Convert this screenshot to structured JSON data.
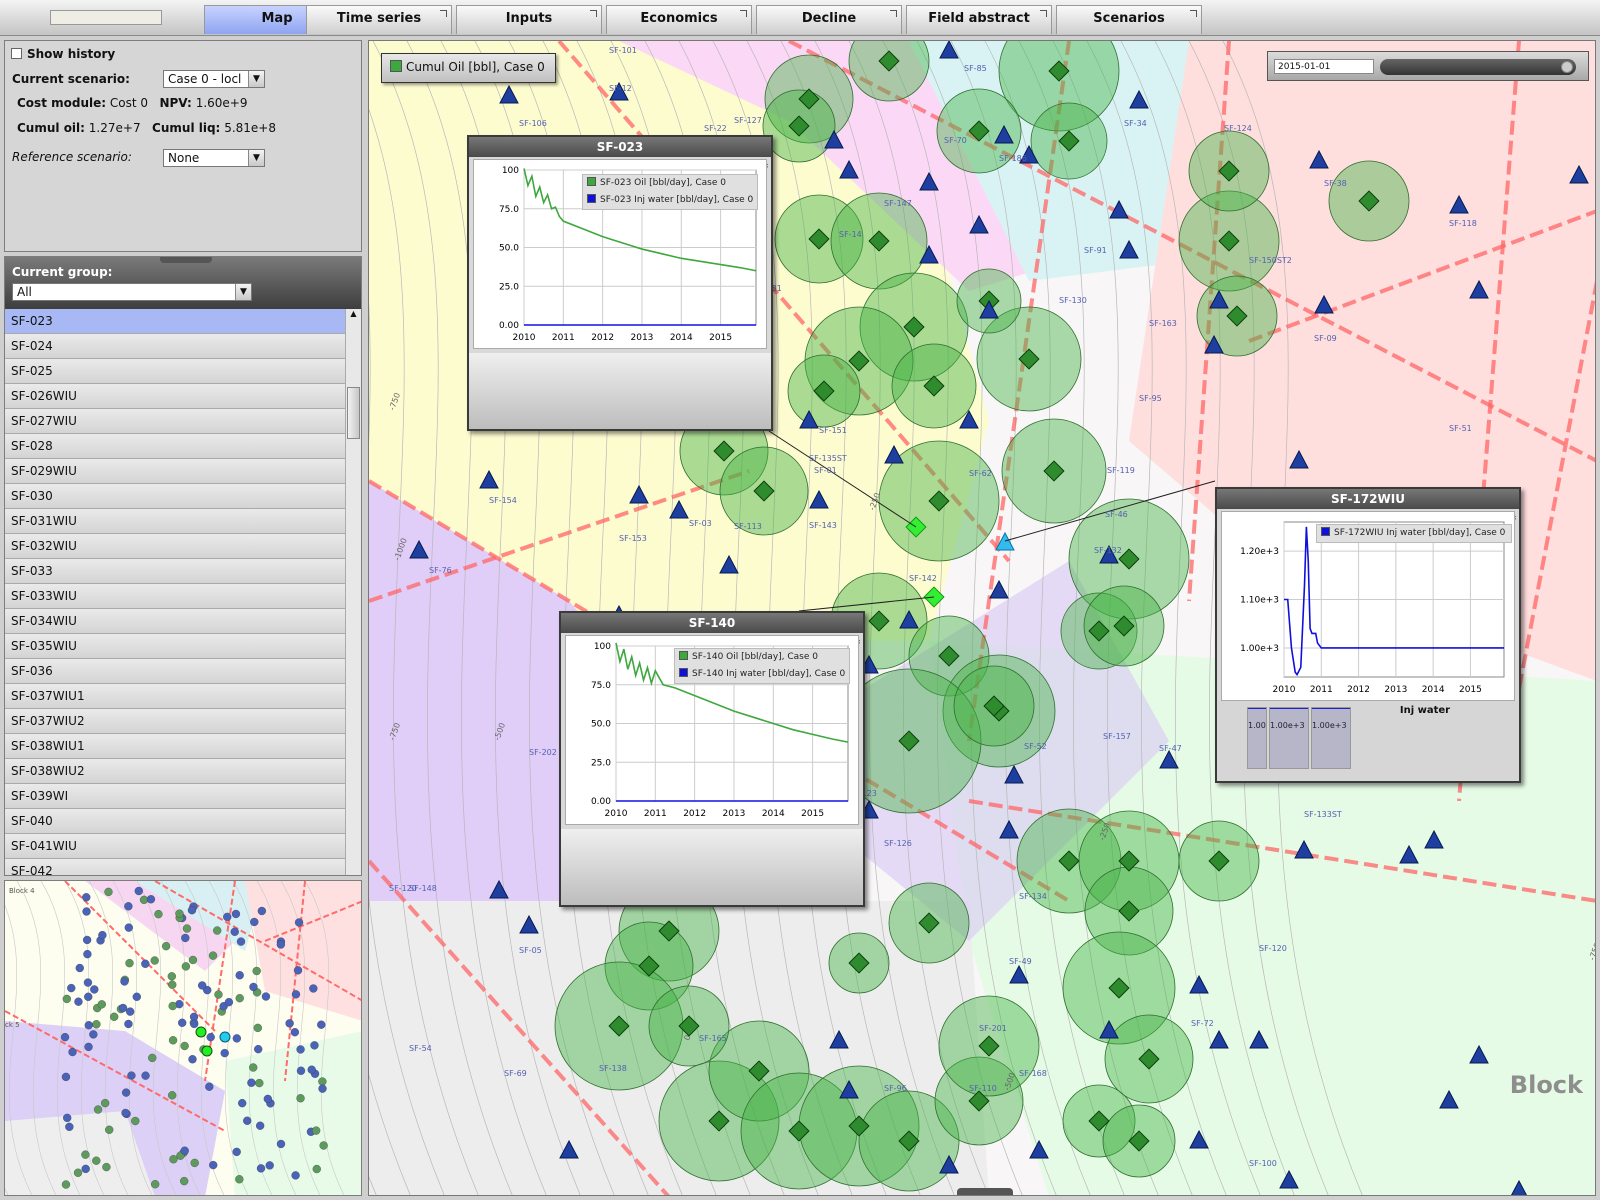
{
  "tabs": [
    "Map",
    "Time series",
    "Inputs",
    "Economics",
    "Decline",
    "Field abstract",
    "Scenarios"
  ],
  "scenario_panel": {
    "show_history_label": "Show history",
    "current_scenario_label": "Current scenario:",
    "current_scenario_value": "Case 0 - locl",
    "cost_module_label": "Cost module:",
    "cost_module_value": "Cost 0",
    "npv_label": "NPV:",
    "npv_value": "1.60e+9",
    "cumul_oil_label": "Cumul oil:",
    "cumul_oil_value": "1.27e+7",
    "cumul_liq_label": "Cumul liq:",
    "cumul_liq_value": "5.81e+8",
    "reference_scenario_label": "Reference scenario:",
    "reference_scenario_value": "None"
  },
  "group_panel": {
    "label": "Current group:",
    "value": "All",
    "wells": [
      "SF-023",
      "SF-024",
      "SF-025",
      "SF-026WIU",
      "SF-027WIU",
      "SF-028",
      "SF-029WIU",
      "SF-030",
      "SF-031WIU",
      "SF-032WIU",
      "SF-033",
      "SF-033WIU",
      "SF-034WIU",
      "SF-035WIU",
      "SF-036",
      "SF-037WIU1",
      "SF-037WIU2",
      "SF-038WIU1",
      "SF-038WIU2",
      "SF-039WI",
      "SF-040",
      "SF-041WIU",
      "SF-042"
    ]
  },
  "minimap": {
    "block_top": "Block 4",
    "block_left": "ck 5"
  },
  "map": {
    "cumul_legend": "Cumul Oil [bbl], Case 0",
    "date": "2015-01-01",
    "block_label": "Block",
    "colors": {
      "producer": "#2e8b2e",
      "producer_bubble": "rgba(70,180,70,0.45)",
      "injector": "#1f3fa0",
      "selected_producer": "#33ee33",
      "selected_injector": "#33bbee",
      "fault": "#ff6666"
    },
    "well_labels": [
      "SF-101",
      "SF-12",
      "SF-106",
      "SF-22",
      "SF-34",
      "SF-38",
      "SF-118",
      "SF-147",
      "SF-14",
      "SF-131",
      "SF-130",
      "SF-150ST2",
      "SF-163",
      "SF-09",
      "SF-95",
      "SF-51",
      "SF-151",
      "SF-135ST",
      "SF-01",
      "SF-154",
      "SF-113",
      "SF-143",
      "SF-153",
      "SF-03",
      "SF-76",
      "SF-119",
      "SF-46",
      "SF-132",
      "SF-202",
      "SF-52",
      "SF-157",
      "SF-47",
      "SF-133ST",
      "SF-05",
      "SF-49",
      "SF-148",
      "SF-120",
      "SF-72",
      "SF-54",
      "SF-69",
      "SF-201",
      "SF-168",
      "SF-100",
      "SF-110",
      "SF-126",
      "SF-134",
      "SF-165",
      "SF-138",
      "SF-96",
      "SF-62",
      "SF-70",
      "SF-127",
      "SF-91",
      "SF-186",
      "SF-85",
      "SF-124",
      "SF-123",
      "SF-142",
      "SF-161",
      "SF-120"
    ],
    "contour_labels": [
      "-250",
      "-500",
      "-750",
      "-1000",
      "0",
      "-250",
      "-500",
      "-750",
      "0",
      "-500",
      "-750",
      "-250",
      "-500",
      "-750"
    ]
  },
  "popups": [
    {
      "title": "SF-023",
      "legend": [
        "SF-023 Oil [bbl/day], Case 0",
        "SF-023 Inj water [bbl/day], Case 0"
      ],
      "legend_colors": [
        "#3da83d",
        "#1010dd"
      ]
    },
    {
      "title": "SF-140",
      "legend": [
        "SF-140 Oil [bbl/day], Case 0",
        "SF-140 Inj water [bbl/day], Case 0"
      ],
      "legend_colors": [
        "#3da83d",
        "#1010dd"
      ]
    },
    {
      "title": "SF-172WIU",
      "legend": [
        "SF-172WIU Inj water [bbl/day], Case 0"
      ],
      "legend_colors": [
        "#1010dd"
      ],
      "bottom_title": "Inj water",
      "bars": [
        "1.00",
        "1.00e+3",
        "1.00e+3"
      ]
    }
  ],
  "chart_data": [
    {
      "type": "line",
      "title": "SF-023",
      "x_ticks": [
        "2010",
        "2011",
        "2012",
        "2013",
        "2014",
        "2015"
      ],
      "y_ticks": [
        "100",
        "75.0",
        "50.0",
        "25.0",
        "0.00"
      ],
      "xlim": [
        2010,
        2015.9
      ],
      "ylim": [
        0,
        100
      ],
      "series": [
        {
          "name": "SF-023 Oil [bbl/day], Case 0",
          "color": "#3da83d",
          "x": [
            2010.0,
            2010.1,
            2010.2,
            2010.3,
            2010.4,
            2010.5,
            2010.6,
            2010.7,
            2010.8,
            2010.9,
            2011.0,
            2011.5,
            2012.0,
            2012.5,
            2013.0,
            2013.5,
            2014.0,
            2014.5,
            2015.0,
            2015.5,
            2015.9
          ],
          "y": [
            101,
            90,
            96,
            83,
            89,
            79,
            84,
            75,
            76,
            70,
            67,
            62,
            57,
            53,
            49,
            46,
            43,
            41,
            39,
            37,
            35
          ]
        },
        {
          "name": "SF-023 Inj water [bbl/day], Case 0",
          "color": "#1010dd",
          "x": [
            2010.0,
            2015.9
          ],
          "y": [
            0,
            0
          ]
        }
      ]
    },
    {
      "type": "line",
      "title": "SF-140",
      "x_ticks": [
        "2010",
        "2011",
        "2012",
        "2013",
        "2014",
        "2015"
      ],
      "y_ticks": [
        "100",
        "75.0",
        "50.0",
        "25.0",
        "0.00"
      ],
      "xlim": [
        2010,
        2015.9
      ],
      "ylim": [
        0,
        100
      ],
      "series": [
        {
          "name": "SF-140 Oil [bbl/day], Case 0",
          "color": "#3da83d",
          "x": [
            2010.0,
            2010.1,
            2010.2,
            2010.3,
            2010.4,
            2010.5,
            2010.6,
            2010.7,
            2010.8,
            2010.9,
            2011.0,
            2011.2,
            2011.5,
            2012.0,
            2012.5,
            2013.0,
            2013.5,
            2014.0,
            2014.5,
            2015.0,
            2015.5,
            2015.9
          ],
          "y": [
            102,
            90,
            98,
            85,
            93,
            81,
            89,
            78,
            86,
            76,
            84,
            75,
            73,
            68,
            63,
            58,
            54,
            50,
            46,
            43,
            40,
            38
          ]
        },
        {
          "name": "SF-140 Inj water [bbl/day], Case 0",
          "color": "#1010dd",
          "x": [
            2010.0,
            2015.9
          ],
          "y": [
            0,
            0
          ]
        }
      ]
    },
    {
      "type": "line",
      "title": "SF-172WIU",
      "x_ticks": [
        "2010",
        "2011",
        "2012",
        "2013",
        "2014",
        "2015"
      ],
      "y_ticks": [
        "1.20e+3",
        "1.10e+3",
        "1.00e+3"
      ],
      "xlim": [
        2010,
        2015.9
      ],
      "ylim": [
        940,
        1260
      ],
      "series": [
        {
          "name": "SF-172WIU Inj water [bbl/day], Case 0",
          "color": "#1010dd",
          "x": [
            2010.0,
            2010.1,
            2010.2,
            2010.3,
            2010.35,
            2010.45,
            2010.55,
            2010.6,
            2010.65,
            2010.7,
            2010.75,
            2010.85,
            2010.9,
            2011.0,
            2011.1,
            2012.0,
            2013.0,
            2014.0,
            2015.0,
            2015.9
          ],
          "y": [
            1100,
            1100,
            1000,
            950,
            945,
            960,
            1130,
            1250,
            1180,
            1040,
            1030,
            1030,
            1010,
            1000,
            1000,
            1000,
            1000,
            1000,
            1000,
            1000
          ]
        }
      ]
    }
  ]
}
